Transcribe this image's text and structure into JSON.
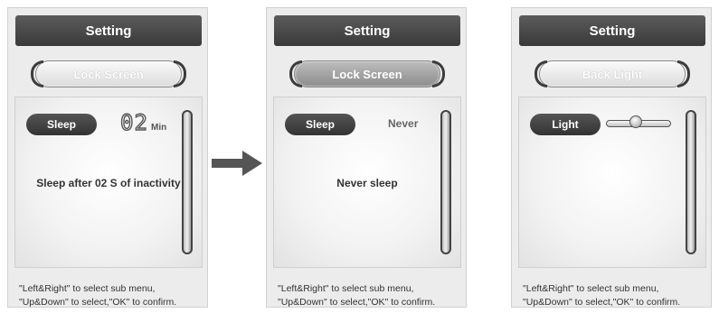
{
  "footer_line1": "\"Left&Right\" to select sub menu,",
  "footer_line2": "\"Up&Down\" to select,\"OK\" to confirm.",
  "panels": [
    {
      "title": "Setting",
      "submenu": "Lock Screen",
      "option_label": "Sleep",
      "value": "02",
      "unit": "Min",
      "message": "Sleep after 02 S of inactivity"
    },
    {
      "title": "Setting",
      "submenu": "Lock Screen",
      "option_label": "Sleep",
      "value": "Never",
      "message": "Never sleep"
    },
    {
      "title": "Setting",
      "submenu": "Back Light",
      "option_label": "Light",
      "brightness_level": 0.45
    }
  ],
  "transition_arrow": "right-arrow-icon"
}
